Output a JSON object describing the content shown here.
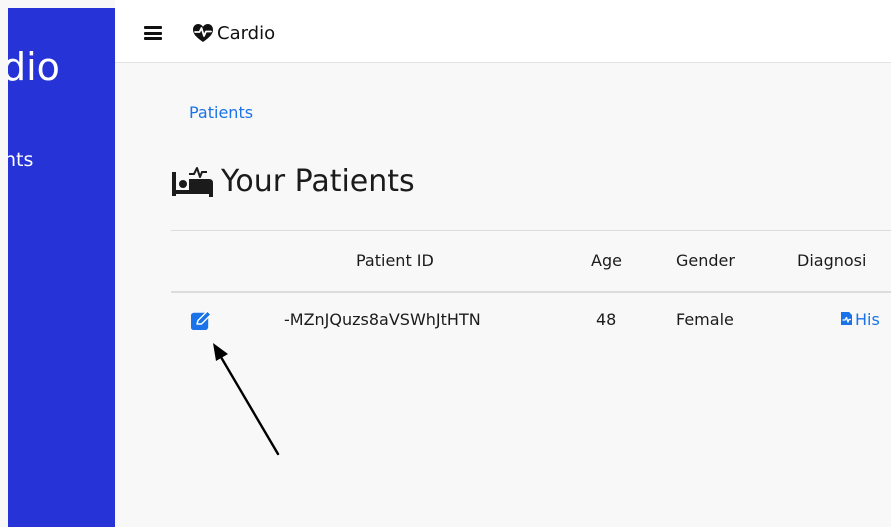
{
  "sidebar": {
    "brand_partial": "dio",
    "nav_link_partial": "nts",
    "background_color": "#2633d6"
  },
  "topbar": {
    "menu_icon": "hamburger-icon",
    "logo_icon": "heart-pulse-icon",
    "title": "Cardio"
  },
  "breadcrumb": {
    "label": "Patients"
  },
  "page": {
    "title_icon": "bed-patient-icon",
    "title": "Your Patients"
  },
  "table": {
    "columns": [
      "Patient ID",
      "Age",
      "Gender",
      "Diagnosi"
    ],
    "rows": [
      {
        "edit_icon": "edit-icon",
        "patient_id": "-MZnJQuzs8aVSWhJtHTN",
        "age": "48",
        "gender": "Female",
        "diagnosis_icon": "file-medical-icon",
        "diagnosis_link_partial": "His"
      }
    ]
  },
  "colors": {
    "accent": "#1a73e8",
    "text": "#1b1b1b"
  }
}
